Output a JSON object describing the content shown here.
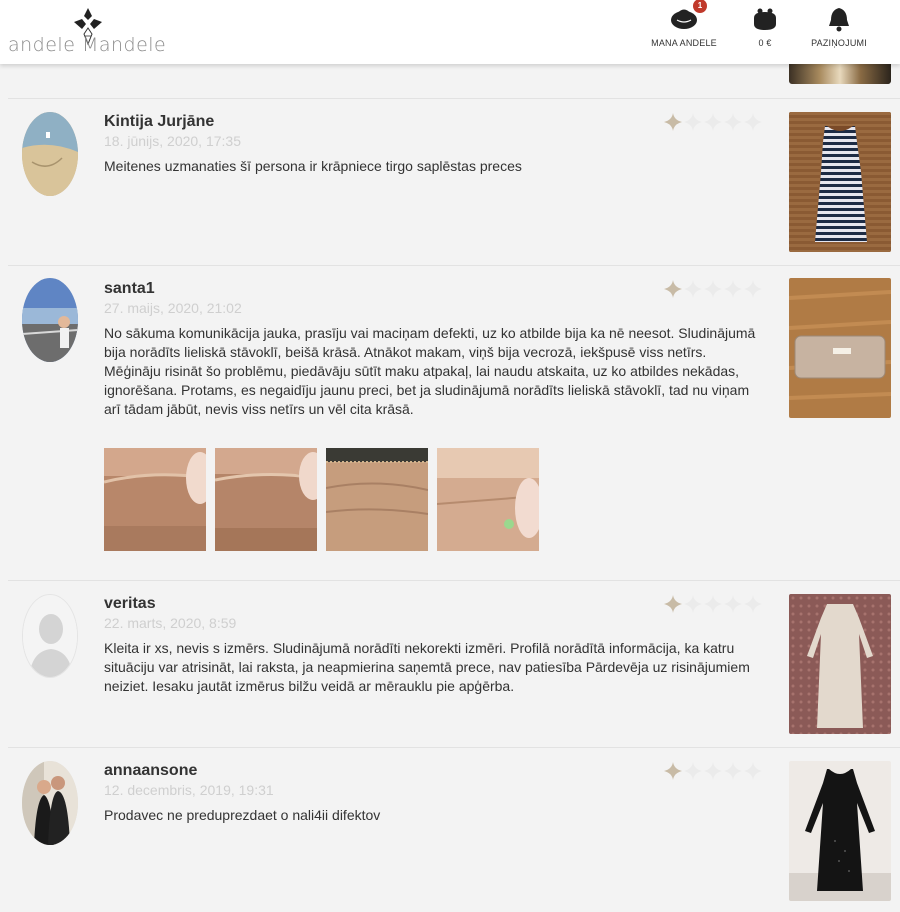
{
  "header": {
    "logo_text": "andele Mandele",
    "nav": [
      {
        "label": "MANA ANDELE",
        "badge": "1",
        "icon": "shopping-bag-icon"
      },
      {
        "label": "0 €",
        "icon": "wallet-icon"
      },
      {
        "label": "PAZIŅOJUMI",
        "icon": "bell-icon"
      }
    ]
  },
  "reviews": [
    {
      "name": "Kintija Jurjāne",
      "date": "18. jūnijs, 2020, 17:35",
      "text": "Meitenes uzmanaties šī persona ir krāpniece tirgo saplēstas preces",
      "rating": 1,
      "product": "striped-dress"
    },
    {
      "name": "santa1",
      "date": "27. maijs, 2020, 21:02",
      "text": "No sākuma komunikācija jauka, prasīju vai maciņam defekti, uz ko atbilde bija ka nē neesot. Sludinājumā bija norādīts lieliskā stāvoklī, beišā krāsā. Atnākot makam, viņš bija vecrozā, iekšpusē viss netīrs. Mēģināju risināt šo problēmu, piedāvāju sūtīt maku atpakaļ, lai naudu atskaita, uz ko atbildes nekādas, ignorēšana. Protams, es negaidīju jaunu preci, bet ja sludinājumā norādīts lieliskā stāvoklī, tad nu viņam arī tādam jābūt, nevis viss netīrs un vēl cita krāsā.",
      "rating": 1,
      "product": "wallet"
    },
    {
      "name": "veritas",
      "date": "22. marts, 2020, 8:59",
      "text": "Kleita ir xs, nevis s izmērs. Sludinājumā norādīti nekorekti izmēri. Profilā norādītā informācija, ka katru situāciju var atrisināt, lai raksta, ja neapmierina saņemtā prece, nav patiesība Pārdevēja uz risinājumiem neiziet. Iesaku jautāt izmērus bilžu veidā ar mērauklu pie apģērba.",
      "rating": 1,
      "product": "beige-dress"
    },
    {
      "name": "annaansone",
      "date": "12. decembris, 2019, 19:31",
      "text": "Prodavec ne preduprezdaet o nali4ii difektov",
      "rating": 1,
      "product": "black-dress"
    }
  ],
  "max_rating": 5,
  "colors": {
    "star_filled": "#c8bba6",
    "star_empty": "#ebebeb",
    "badge": "#c0392b",
    "date": "#cfcfcf"
  }
}
